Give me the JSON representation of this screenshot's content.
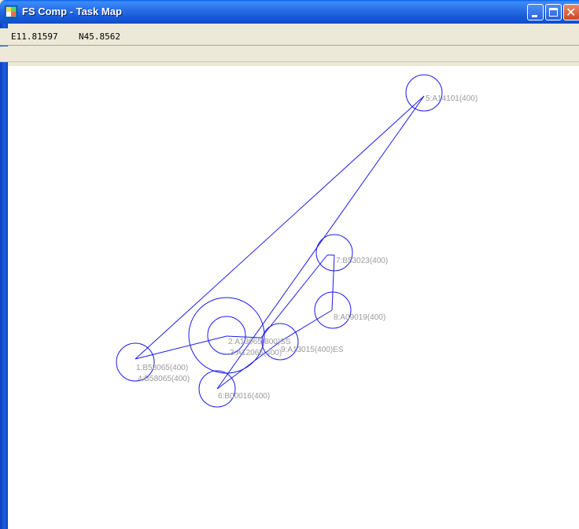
{
  "window": {
    "title": "FS Comp - Task Map",
    "controls": [
      "minimize",
      "maximize",
      "close"
    ]
  },
  "coordinates": {
    "east": "E11.81597",
    "north": "N45.8562"
  },
  "colors": {
    "route": "#1a1aee",
    "label": "#9a9a9a",
    "map_background": "#ffffff"
  },
  "map": {
    "waypoints": [
      {
        "label": "5:A14101(400)"
      },
      {
        "label": "7:B53023(400)"
      },
      {
        "label": "8:A09019(400)"
      },
      {
        "label": "2:A13065(800)SS"
      },
      {
        "label": "3:A12065(400)"
      },
      {
        "label": "9:A13015(400)ES"
      },
      {
        "label": "1:B58065(400)"
      },
      {
        "label": "4:B58065(400)"
      },
      {
        "label": "6:B00016(400)"
      }
    ]
  }
}
